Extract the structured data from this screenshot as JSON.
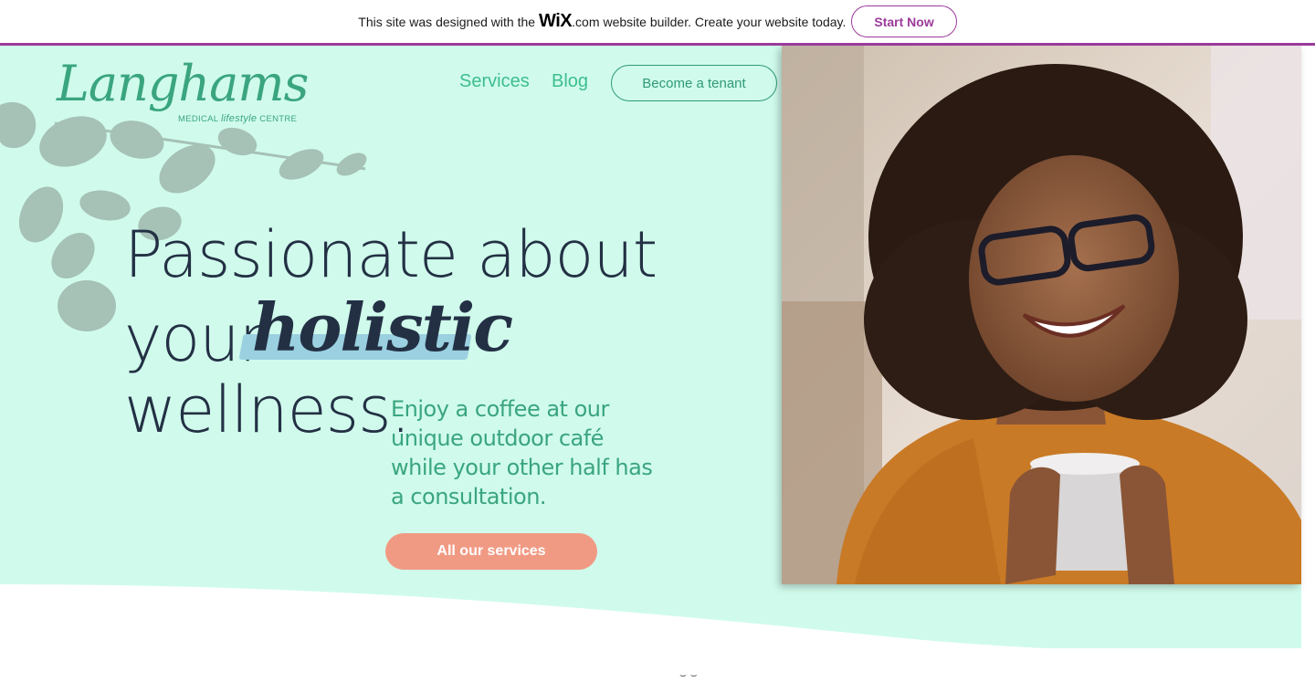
{
  "wix_banner": {
    "text_before": "This site was designed with the",
    "wix_logo": "WiX",
    "wix_suffix": ".com",
    "text_after": "website builder. Create your website today.",
    "start_button": "Start Now",
    "accent_color": "#9b3a9b"
  },
  "logo": {
    "script": "Langhams",
    "sub_medical": "MEDICAL",
    "sub_lifestyle": "lifestyle",
    "sub_centre": "CENTRE"
  },
  "nav": {
    "services": "Services",
    "blog": "Blog",
    "tenant_button": "Become a tenant"
  },
  "hero": {
    "line1": "Passionate about",
    "line2": "your",
    "highlight": "holistic",
    "line3": "wellness.",
    "subcopy": "Enjoy a coffee at our unique outdoor café while your other half has a consultation.",
    "cta": "All our services"
  },
  "colors": {
    "hero_bg": "#d0fbec",
    "brand_green": "#3aa57f",
    "navy": "#233044",
    "cta": "#f19a83",
    "highlight_stroke": "#9bd0e0"
  },
  "icons": {
    "leaves": "leaf-shadow-icon",
    "photo": "smiling-woman-with-coffee-photo"
  }
}
